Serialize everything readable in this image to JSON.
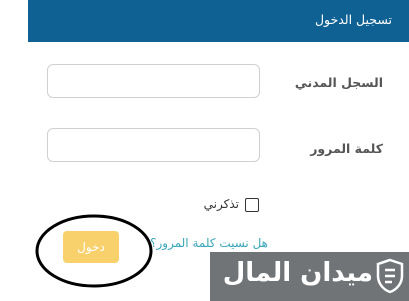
{
  "header": {
    "title": "تسجيل الدخول"
  },
  "form": {
    "civil_id": {
      "label": "السجل المدني",
      "value": "",
      "placeholder": ""
    },
    "password": {
      "label": "كلمة المرور",
      "value": "",
      "placeholder": ""
    },
    "remember_me": {
      "label": "تذكرني",
      "checked": false
    },
    "forgot_password_link": "هل نسيت كلمة المرور؟",
    "login_button": "دخول"
  },
  "watermark": {
    "text": "ميدان المال"
  },
  "colors": {
    "header_bg": "#0f6193",
    "button_bg": "#f8d16c",
    "link": "#3aa6b9",
    "watermark_bg": "#707477"
  }
}
